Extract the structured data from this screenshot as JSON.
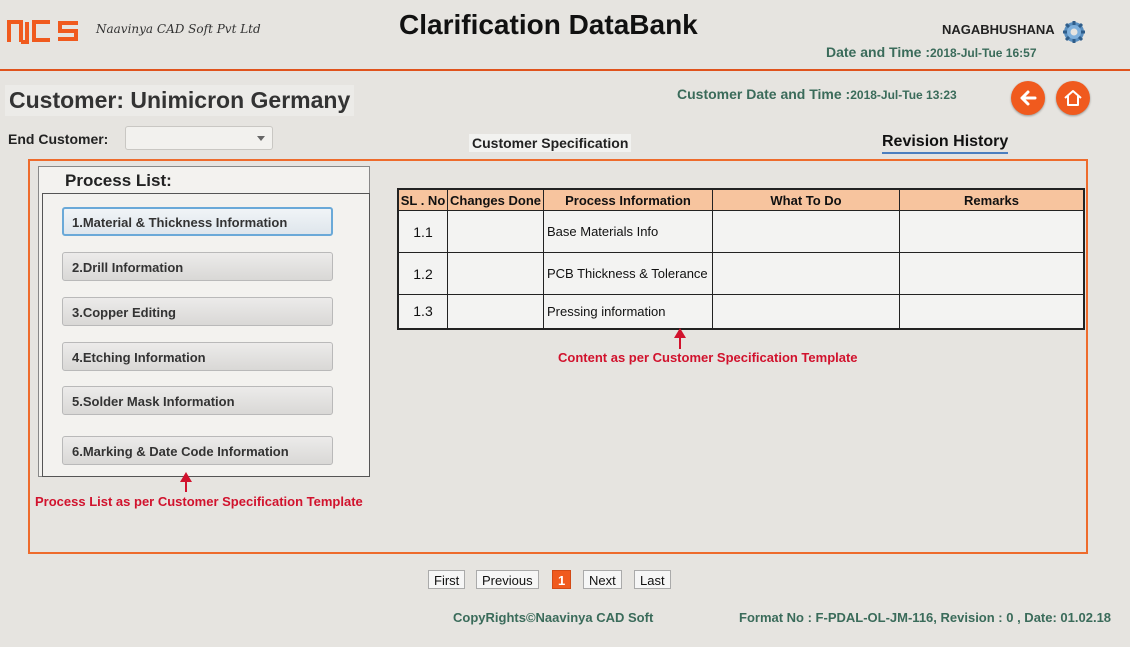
{
  "header": {
    "logo_text": "NCS",
    "company": "Naavinya CAD Soft Pvt Ltd",
    "app_title": "Clarification DataBank",
    "username": "NAGABHUSHANA",
    "datetime_label": "Date and Time :",
    "datetime_value": "2018-Jul-Tue 16:57",
    "accent_color": "#e0531d"
  },
  "customer": {
    "label": "Customer: Unimicron Germany",
    "datetime_label": "Customer Date and Time :",
    "datetime_value": "2018-Jul-Tue 13:23",
    "end_customer_label": "End Customer:",
    "end_customer_value": ""
  },
  "tabs": {
    "spec": "Customer Specification",
    "revision": "Revision History"
  },
  "process_list": {
    "title": "Process List:",
    "items": [
      {
        "label": "1.Material & Thickness Information"
      },
      {
        "label": "2.Drill Information"
      },
      {
        "label": "3.Copper Editing"
      },
      {
        "label": "4.Etching Information"
      },
      {
        "label": "5.Solder Mask Information"
      },
      {
        "label": "6.Marking & Date Code Information"
      }
    ],
    "note": "Process List as per Customer Specification Template"
  },
  "table": {
    "headers": [
      "SL . No",
      "Changes Done",
      "Process Information",
      "What To Do",
      "Remarks"
    ],
    "rows": [
      [
        "1.1",
        "",
        "Base Materials Info",
        "",
        ""
      ],
      [
        "1.2",
        "",
        "PCB Thickness & Tolerance",
        "",
        ""
      ],
      [
        "1.3",
        "",
        "Pressing information",
        "",
        ""
      ]
    ],
    "note": "Content as per Customer Specification Template"
  },
  "pagination": {
    "first": "First",
    "previous": "Previous",
    "current": "1",
    "next": "Next",
    "last": "Last"
  },
  "footer": {
    "copyright": "CopyRights©Naavinya CAD Soft",
    "format_no": "Format No : F-PDAL-OL-JM-116, Revision : 0 , Date: 01.02.18"
  },
  "icons": {
    "settings": "gear-icon",
    "back": "arrow-left-icon",
    "home": "home-icon"
  }
}
